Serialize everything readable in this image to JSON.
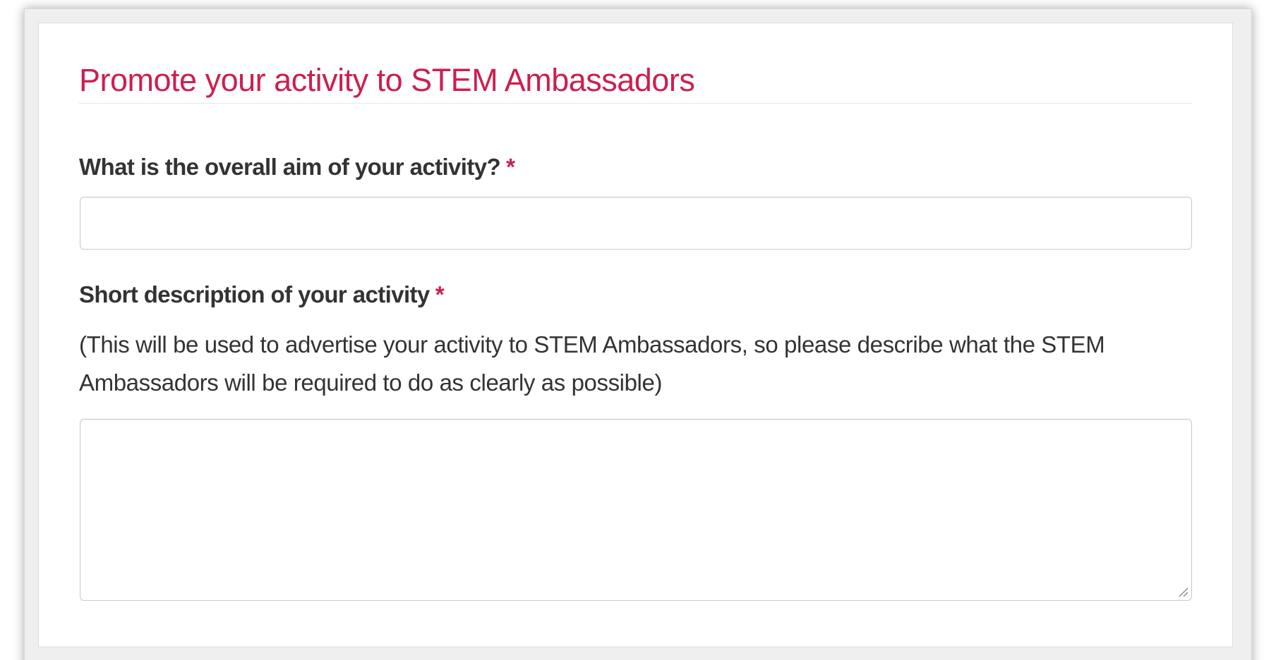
{
  "section": {
    "title": "Promote your activity to STEM Ambassadors"
  },
  "fields": {
    "aim": {
      "label": "What is the overall aim of your activity?",
      "required_marker": "*",
      "value": "",
      "placeholder": ""
    },
    "description": {
      "label": "Short description of your activity",
      "required_marker": "*",
      "help_text": "(This will be used to advertise your activity to STEM Ambassadors, so please describe what the STEM Ambassadors will be required to do as clearly as possible)",
      "value": "",
      "placeholder": ""
    }
  },
  "colors": {
    "accent": "#cc1f4f",
    "label_text": "#333333",
    "input_border": "#cccccc"
  },
  "icons": {
    "resize_handle": "resize-handle-icon"
  }
}
